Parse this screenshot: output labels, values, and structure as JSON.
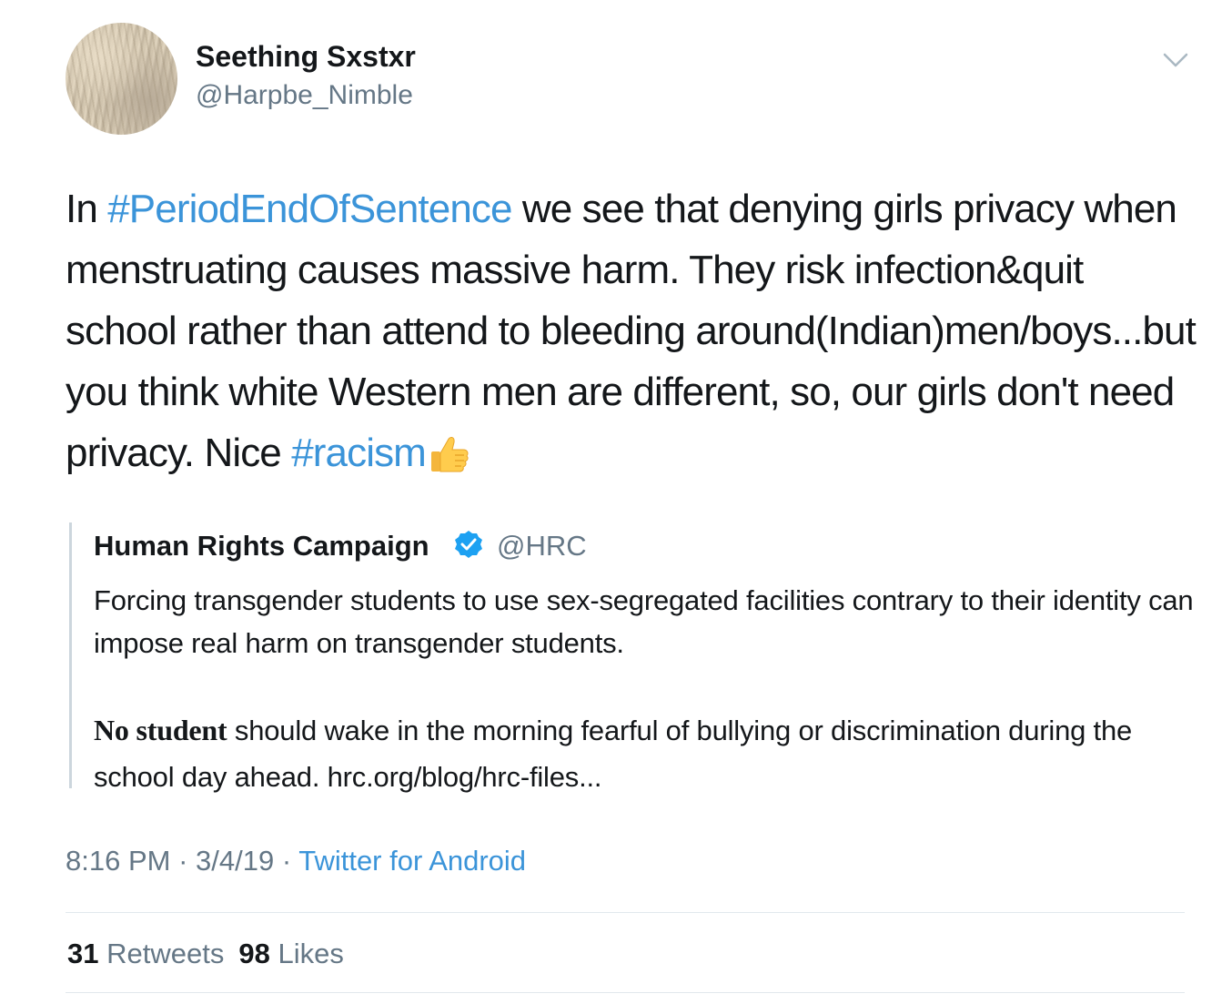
{
  "author": {
    "name": "Seething Sxstxr",
    "handle": "@Harpbe_Nimble"
  },
  "tweet": {
    "t1": "In ",
    "hashtag1": "#PeriodEndOfSentence",
    "t2": " we see that denying girls privacy when menstruating causes massive harm. They risk infection&quit school rather than attend to bleeding around(Indian)men/boys...but you think white Western men are different, so, our girls don't need privacy. Nice ",
    "hashtag2": "#racism",
    "emoji": "thumbs-up-icon"
  },
  "quoted": {
    "name": "Human Rights Campaign",
    "handle": "@HRC",
    "text1": "Forcing transgender students to use sex-segregated facilities contrary to their identity can impose real harm on transgender students.",
    "bold_lead": "No student",
    "text2": " should wake in the morning fearful of bullying or discrimination during the school day ahead. hrc.org/blog/hrc-files..."
  },
  "meta": {
    "time": "8:16 PM",
    "sep1": " · ",
    "date": "3/4/19",
    "sep2": " · ",
    "source": "Twitter for Android"
  },
  "stats": {
    "retweets_count": "31",
    "retweets_label": "Retweets",
    "likes_count": "98",
    "likes_label": "Likes"
  },
  "colors": {
    "link": "#3b94d9",
    "secondary_text": "#657786",
    "divider": "#e1e8ed",
    "verified": "#1da1f2"
  }
}
